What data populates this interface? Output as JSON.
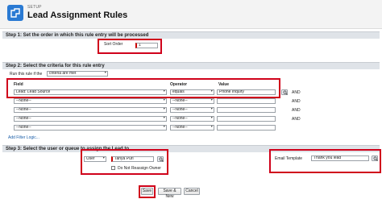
{
  "header": {
    "setup_label": "SETUP",
    "page_title": "Lead Assignment Rules"
  },
  "step1": {
    "title": "Step 1: Set the order in which this rule entry will be processed",
    "sort_order_label": "Sort Order",
    "sort_order_value": "1"
  },
  "step2": {
    "title": "Step 2: Select the criteria for this rule entry",
    "run_rule_label": "Run this rule if the",
    "run_rule_value": "criteria are met",
    "col_field": "Field",
    "col_operator": "Operator",
    "col_value": "Value",
    "rows": [
      {
        "field": "Lead: Lead Source",
        "operator": "equals",
        "value": "Phone Inquiry",
        "and": "AND"
      },
      {
        "field": "--None--",
        "operator": "--None--",
        "value": "",
        "and": "AND"
      },
      {
        "field": "--None--",
        "operator": "--None--",
        "value": "",
        "and": "AND"
      },
      {
        "field": "--None--",
        "operator": "--None--",
        "value": "",
        "and": "AND"
      },
      {
        "field": "--None--",
        "operator": "--None--",
        "value": "",
        "and": ""
      }
    ],
    "add_filter_logic": "Add Filter Logic..."
  },
  "step3": {
    "title": "Step 3: Select the user or queue to assign the Lead to",
    "assignee_type": "User",
    "assignee_name": "Tanya Puri",
    "do_not_reassign_label": "Do Not Reassign Owner",
    "email_template_label": "Email Template",
    "email_template_value": "Thank you lead"
  },
  "buttons": {
    "save": "Save",
    "save_new": "Save & New",
    "cancel": "Cancel"
  },
  "colors": {
    "highlight": "#d0021b",
    "brand_blue": "#2a7ad3",
    "required": "#cc0000"
  }
}
